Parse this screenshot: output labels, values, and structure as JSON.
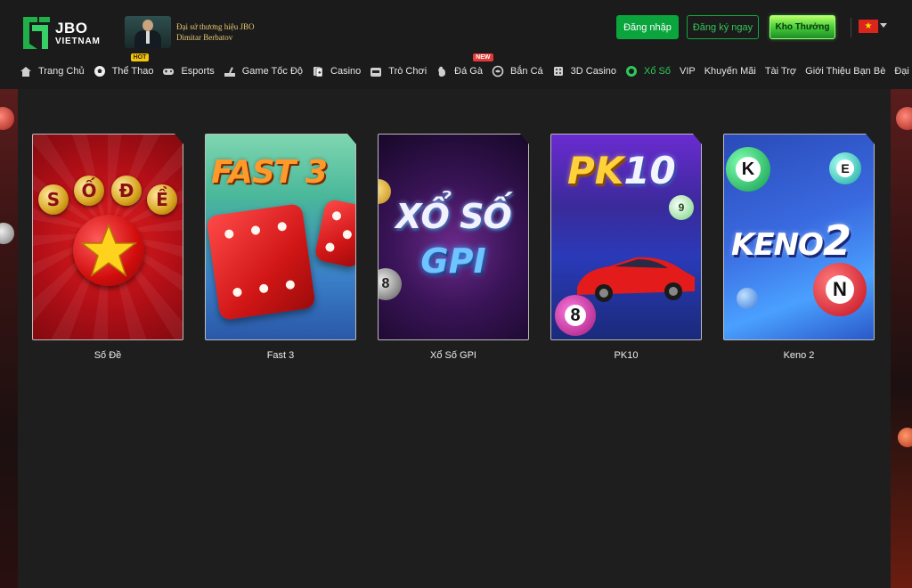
{
  "header": {
    "logo": {
      "line1": "JBO",
      "line2": "VIETNAM"
    },
    "ambassador": {
      "line1": "Đại sứ thương hiệu JBO",
      "line2": "Dimitar Berbatov"
    },
    "login_label": "Đăng nhập",
    "register_label": "Đăng ký ngay",
    "reward_label": "Kho Thưởng",
    "language_flag": "vietnam-flag"
  },
  "nav": {
    "items": [
      {
        "label": "Trang Chủ",
        "icon": "home-icon"
      },
      {
        "label": "Thể Thao",
        "icon": "soccer-ball-icon",
        "badge": "HOT"
      },
      {
        "label": "Esports",
        "icon": "gamepad-icon"
      },
      {
        "label": "Game Tốc Độ",
        "icon": "speed-game-icon"
      },
      {
        "label": "Casino",
        "icon": "cards-icon"
      },
      {
        "label": "Trò Chơi",
        "icon": "slot-machine-icon"
      },
      {
        "label": "Đá Gà",
        "icon": "rooster-icon",
        "badge": "NEW"
      },
      {
        "label": "Bắn Cá",
        "icon": "fish-icon"
      },
      {
        "label": "3D Casino",
        "icon": "dice-icon"
      },
      {
        "label": "Xổ Số",
        "icon": "lottery-ball-icon",
        "active": true
      },
      {
        "label": "VIP"
      },
      {
        "label": "Khuyến Mãi"
      },
      {
        "label": "Tài Trợ"
      },
      {
        "label": "Giới Thiệu Bạn Bè"
      },
      {
        "label": "Đại Lý"
      }
    ],
    "active_color": "#2ec85a"
  },
  "games": [
    {
      "title": "Số Đề",
      "art": {
        "balls": [
          "S",
          "Ố",
          "Đ",
          "Ề"
        ]
      }
    },
    {
      "title": "Fast 3",
      "art": {
        "text": "FAST 3"
      }
    },
    {
      "title": "Xổ Số GPI",
      "art": {
        "line1": "XỔ SỐ",
        "line2": "GPI"
      }
    },
    {
      "title": "PK10",
      "art": {
        "text_a": "PK",
        "text_b": "10",
        "ball": "9",
        "ball2": "8"
      }
    },
    {
      "title": "Keno 2",
      "art": {
        "text": "KENO",
        "num": "2",
        "balls": [
          "K",
          "E",
          "N"
        ]
      }
    }
  ],
  "colors": {
    "background": "#1e1e1e",
    "header": "#1b1b1b",
    "primary_green": "#0aa53c"
  }
}
